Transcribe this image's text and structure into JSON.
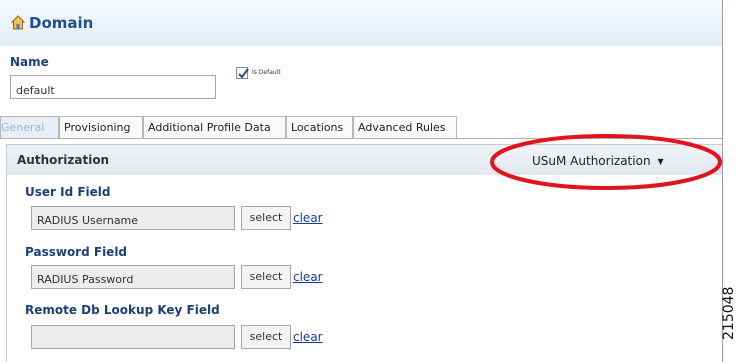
{
  "title_bar": {
    "title": "Domain",
    "icon": "domain-house-icon"
  },
  "name_section": {
    "label": "Name",
    "value": "default",
    "is_default_label": "Is Default",
    "is_default_checked": true
  },
  "tabs": [
    {
      "label": "General",
      "active": true
    },
    {
      "label": "Provisioning",
      "active": false
    },
    {
      "label": "Additional Profile Data",
      "active": false
    },
    {
      "label": "Locations",
      "active": false
    },
    {
      "label": "Advanced Rules",
      "active": false
    }
  ],
  "panel": {
    "title": "Authorization",
    "auth_dropdown": {
      "selected": "USuM Authorization",
      "caret": "▼"
    },
    "fields": [
      {
        "label": "User Id Field",
        "value": "RADIUS Username",
        "select_label": "select",
        "clear_label": "clear"
      },
      {
        "label": "Password Field",
        "value": "RADIUS Password",
        "select_label": "select",
        "clear_label": "clear"
      },
      {
        "label": "Remote Db Lookup Key Field",
        "value": "",
        "select_label": "select",
        "clear_label": "clear"
      }
    ]
  },
  "annotation": {
    "shape": "ellipse",
    "color": "#e0141e"
  },
  "figure_id": "215048",
  "colors": {
    "title": "#1d4f91",
    "field_label": "#1d3f7a",
    "link": "#1a3a9a",
    "highlight": "#e0141e"
  }
}
